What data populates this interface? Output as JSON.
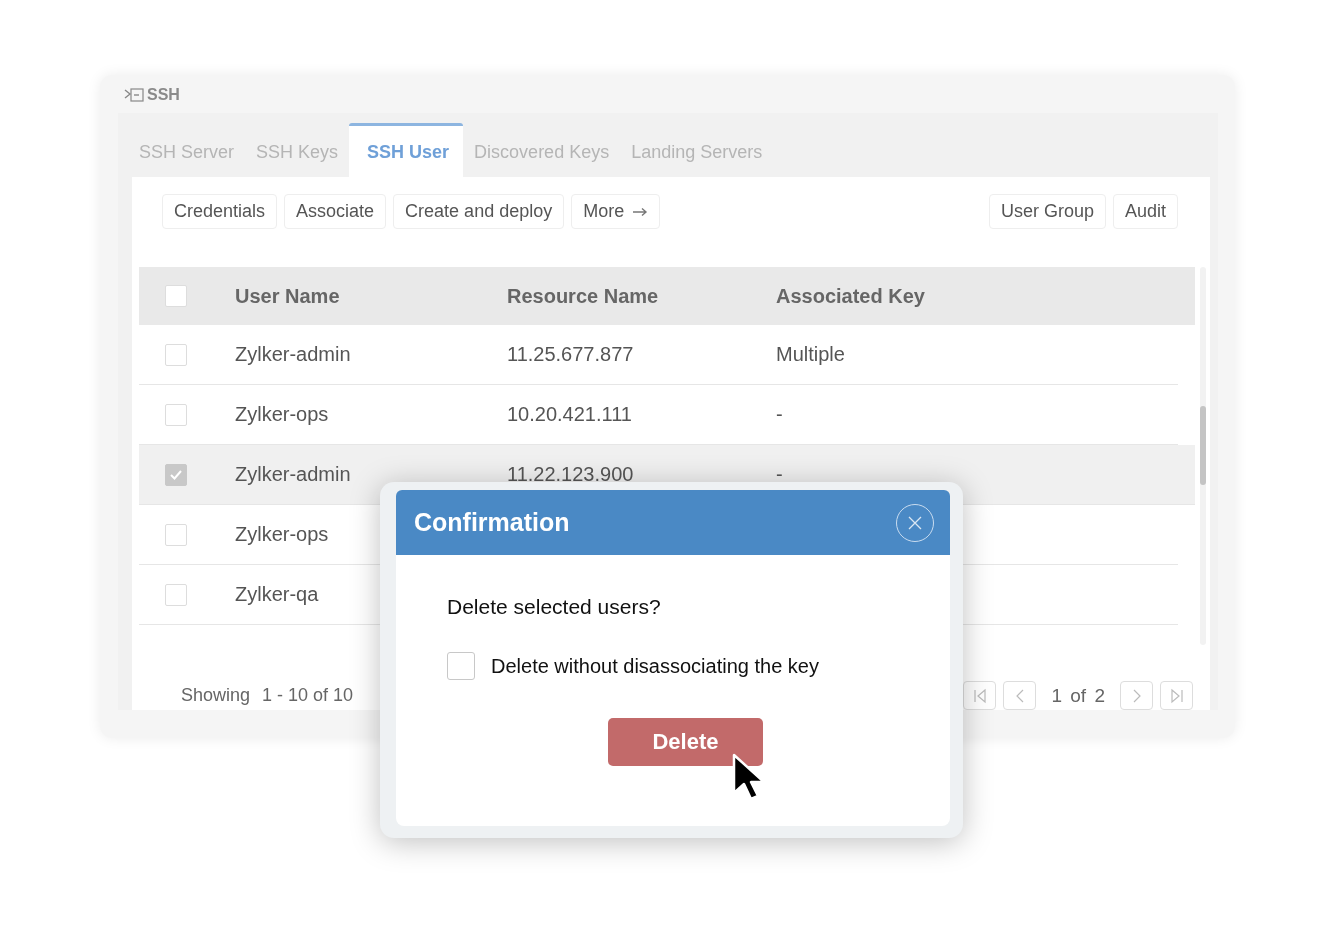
{
  "window": {
    "title": "SSH"
  },
  "tabs": [
    {
      "label": "SSH Server",
      "selected": false
    },
    {
      "label": "SSH Keys",
      "selected": false
    },
    {
      "label": "SSH User",
      "selected": true
    },
    {
      "label": "Discovered Keys",
      "selected": false
    },
    {
      "label": "Landing Servers",
      "selected": false
    }
  ],
  "toolbar": {
    "left": [
      {
        "label": "Credentials"
      },
      {
        "label": "Associate"
      },
      {
        "label": "Create and deploy"
      },
      {
        "label": "More",
        "kind": "arrow"
      }
    ],
    "right": [
      {
        "label": "User Group"
      },
      {
        "label": "Audit"
      }
    ]
  },
  "table": {
    "header_checked": false,
    "columns": [
      "User Name",
      "Resource Name",
      "Associated Key"
    ],
    "rows": [
      {
        "checked": false,
        "selected": false,
        "user": "Zylker-admin",
        "resource": "11.25.677.877",
        "key": "Multiple"
      },
      {
        "checked": false,
        "selected": false,
        "user": "Zylker-ops",
        "resource": "10.20.421.111",
        "key": "-"
      },
      {
        "checked": true,
        "selected": true,
        "user": "Zylker-admin",
        "resource": "11.22.123.900",
        "key": "-"
      },
      {
        "checked": false,
        "selected": false,
        "user": "Zylker-ops"
      },
      {
        "checked": false,
        "selected": false,
        "user": "Zylker-qa"
      }
    ]
  },
  "footer": {
    "showing_label": "Showing",
    "range": "1 - 10 of 10",
    "page": "1 of 2"
  },
  "dialog": {
    "title": "Confirmation",
    "question": "Delete selected users?",
    "option": {
      "label": "Delete without disassociating the key",
      "checked": false
    },
    "button": "Delete"
  }
}
